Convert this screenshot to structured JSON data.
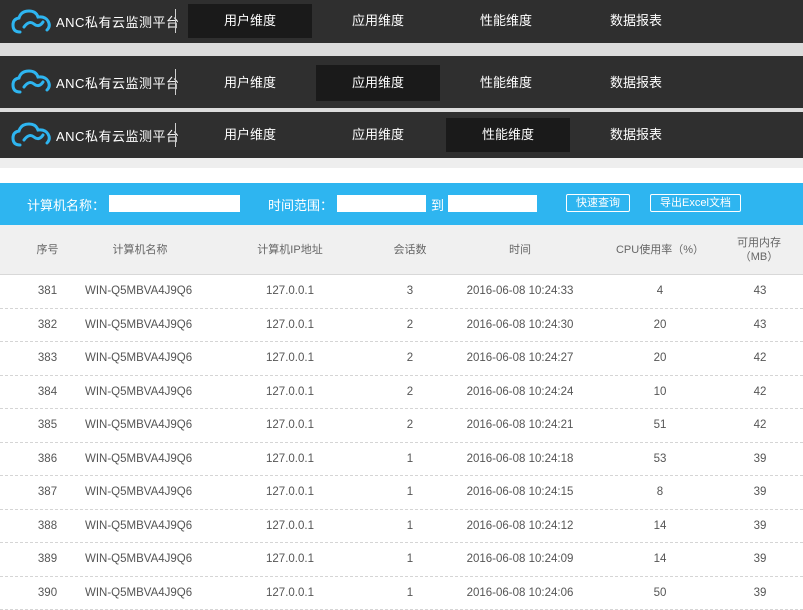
{
  "brand": {
    "name": "ANC私有云监测平台"
  },
  "navbars": [
    {
      "items": [
        "用户维度",
        "应用维度",
        "性能维度",
        "数据报表"
      ],
      "active": 0
    },
    {
      "items": [
        "用户维度",
        "应用维度",
        "性能维度",
        "数据报表"
      ],
      "active": 1
    },
    {
      "items": [
        "用户维度",
        "应用维度",
        "性能维度",
        "数据报表"
      ],
      "active": 2
    }
  ],
  "filter": {
    "computer_name_label": "计算机名称：",
    "computer_name_value": "",
    "time_range_label": "时间范围：",
    "time_start_value": "",
    "to_label": "到",
    "time_end_value": "",
    "quick_query_label": "快速查询",
    "export_excel_label": "导出Excel文档"
  },
  "table": {
    "headers": [
      "序号",
      "计算机名称",
      "计算机IP地址",
      "会话数",
      "时间",
      "CPU使用率（%）",
      "可用内存（MB）"
    ],
    "rows": [
      [
        "381",
        "WIN-Q5MBVA4J9Q6",
        "127.0.0.1",
        "3",
        "2016-06-08 10:24:33",
        "4",
        "43"
      ],
      [
        "382",
        "WIN-Q5MBVA4J9Q6",
        "127.0.0.1",
        "2",
        "2016-06-08 10:24:30",
        "20",
        "43"
      ],
      [
        "383",
        "WIN-Q5MBVA4J9Q6",
        "127.0.0.1",
        "2",
        "2016-06-08 10:24:27",
        "20",
        "42"
      ],
      [
        "384",
        "WIN-Q5MBVA4J9Q6",
        "127.0.0.1",
        "2",
        "2016-06-08 10:24:24",
        "10",
        "42"
      ],
      [
        "385",
        "WIN-Q5MBVA4J9Q6",
        "127.0.0.1",
        "2",
        "2016-06-08 10:24:21",
        "51",
        "42"
      ],
      [
        "386",
        "WIN-Q5MBVA4J9Q6",
        "127.0.0.1",
        "1",
        "2016-06-08 10:24:18",
        "53",
        "39"
      ],
      [
        "387",
        "WIN-Q5MBVA4J9Q6",
        "127.0.0.1",
        "1",
        "2016-06-08 10:24:15",
        "8",
        "39"
      ],
      [
        "388",
        "WIN-Q5MBVA4J9Q6",
        "127.0.0.1",
        "1",
        "2016-06-08 10:24:12",
        "14",
        "39"
      ],
      [
        "389",
        "WIN-Q5MBVA4J9Q6",
        "127.0.0.1",
        "1",
        "2016-06-08 10:24:09",
        "14",
        "39"
      ],
      [
        "390",
        "WIN-Q5MBVA4J9Q6",
        "127.0.0.1",
        "1",
        "2016-06-08 10:24:06",
        "50",
        "39"
      ]
    ]
  },
  "colors": {
    "navbar": "#2f2f2f",
    "nav_active": "#1a1a1a",
    "filter_bar": "#2eb5f0",
    "cloud_icon": "#2eb5f0"
  },
  "icons": {
    "brand": "cloud-logo-icon"
  }
}
